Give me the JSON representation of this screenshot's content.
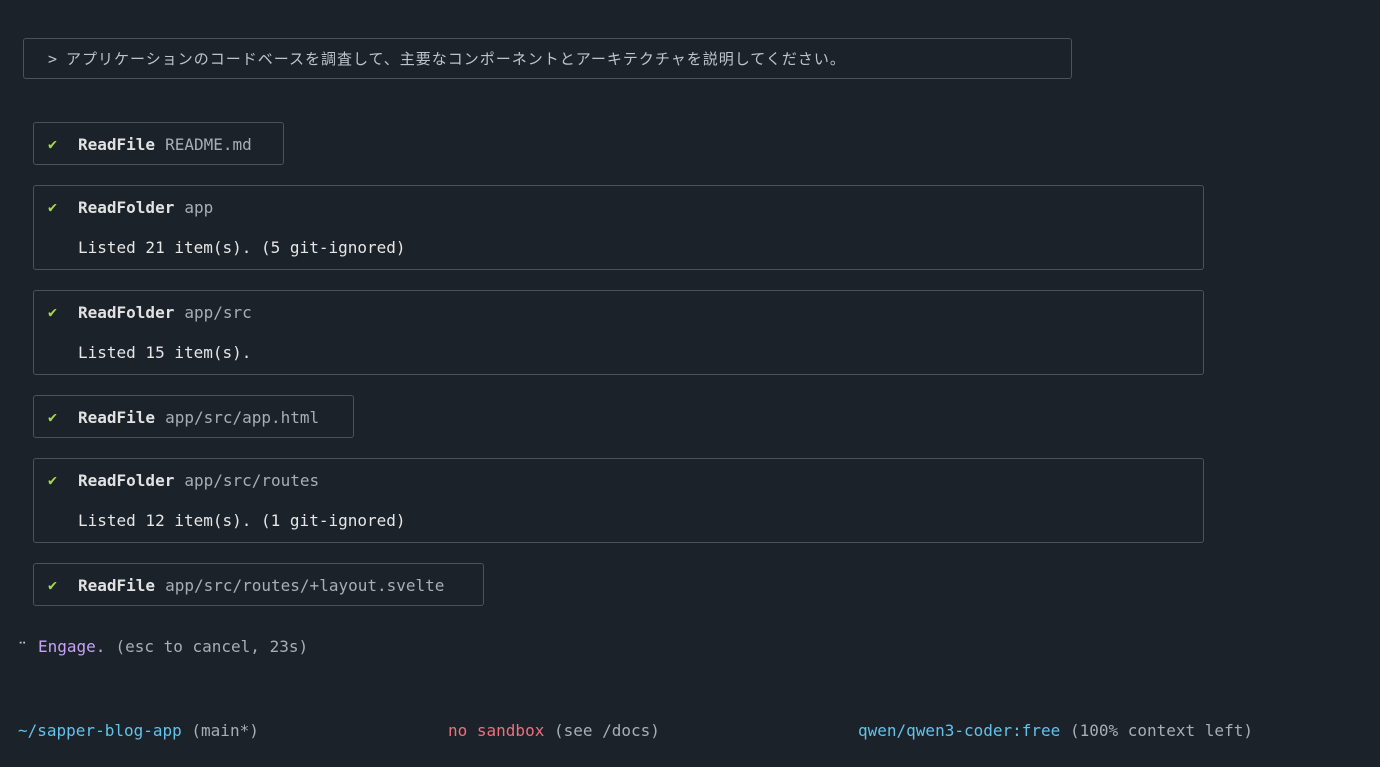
{
  "prompt": {
    "symbol": ">",
    "text": "アプリケーションのコードベースを調査して、主要なコンポーネントとアーキテクチャを説明してください。"
  },
  "tools": [
    {
      "icon": "✔",
      "name": "ReadFile",
      "arg": "README.md",
      "result": ""
    },
    {
      "icon": "✔",
      "name": "ReadFolder",
      "arg": "app",
      "result": "Listed 21 item(s). (5 git-ignored)"
    },
    {
      "icon": "✔",
      "name": "ReadFolder",
      "arg": "app/src",
      "result": "Listed 15 item(s)."
    },
    {
      "icon": "✔",
      "name": "ReadFile",
      "arg": "app/src/app.html",
      "result": ""
    },
    {
      "icon": "✔",
      "name": "ReadFolder",
      "arg": "app/src/routes",
      "result": "Listed 12 item(s). (1 git-ignored)"
    },
    {
      "icon": "✔",
      "name": "ReadFile",
      "arg": "app/src/routes/+layout.svelte",
      "result": ""
    }
  ],
  "status": {
    "spinner": "⠉",
    "text": "Engage.",
    "hint": "(esc to cancel, 23s)"
  },
  "footer": {
    "path": "~/sapper-blog-app",
    "branch": "(main*)",
    "sandbox": "no sandbox",
    "sandbox_hint": "(see /docs)",
    "model": "qwen/qwen3-coder:free",
    "context": "(100% context left)"
  },
  "colors": {
    "background": "#1b222a",
    "check": "#a6d94b",
    "accent_blue": "#63c2ea",
    "accent_red": "#ef6f7b",
    "accent_purple": "#c8a2f5"
  }
}
